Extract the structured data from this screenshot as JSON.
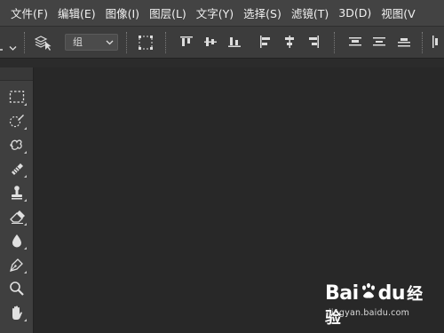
{
  "menu": {
    "items": [
      "文件(F)",
      "编辑(E)",
      "图像(I)",
      "图层(L)",
      "文字(Y)",
      "选择(S)",
      "滤镜(T)",
      "3D(D)",
      "视图(V"
    ]
  },
  "options": {
    "group_select": "组"
  },
  "tools": [
    {
      "icon": "marquee-tool-icon"
    },
    {
      "icon": "quick-selection-tool-icon"
    },
    {
      "icon": "spot-healing-brush-tool-icon"
    },
    {
      "icon": "brush-tool-icon"
    },
    {
      "icon": "clone-stamp-tool-icon"
    },
    {
      "icon": "eraser-tool-icon"
    },
    {
      "icon": "blur-tool-icon"
    },
    {
      "icon": "pen-tool-icon"
    },
    {
      "icon": "zoom-tool-icon"
    },
    {
      "icon": "hand-tool-icon"
    }
  ],
  "watermark": {
    "logo_text_1": "Bai",
    "logo_text_2": "du",
    "logo_text_3": "经验",
    "url": "jingyan.baidu.com"
  },
  "colors": {
    "menubar": "#434343",
    "optionsbar": "#3c3c3c",
    "toolpanel": "#3f3f3f",
    "canvas": "#282828"
  }
}
